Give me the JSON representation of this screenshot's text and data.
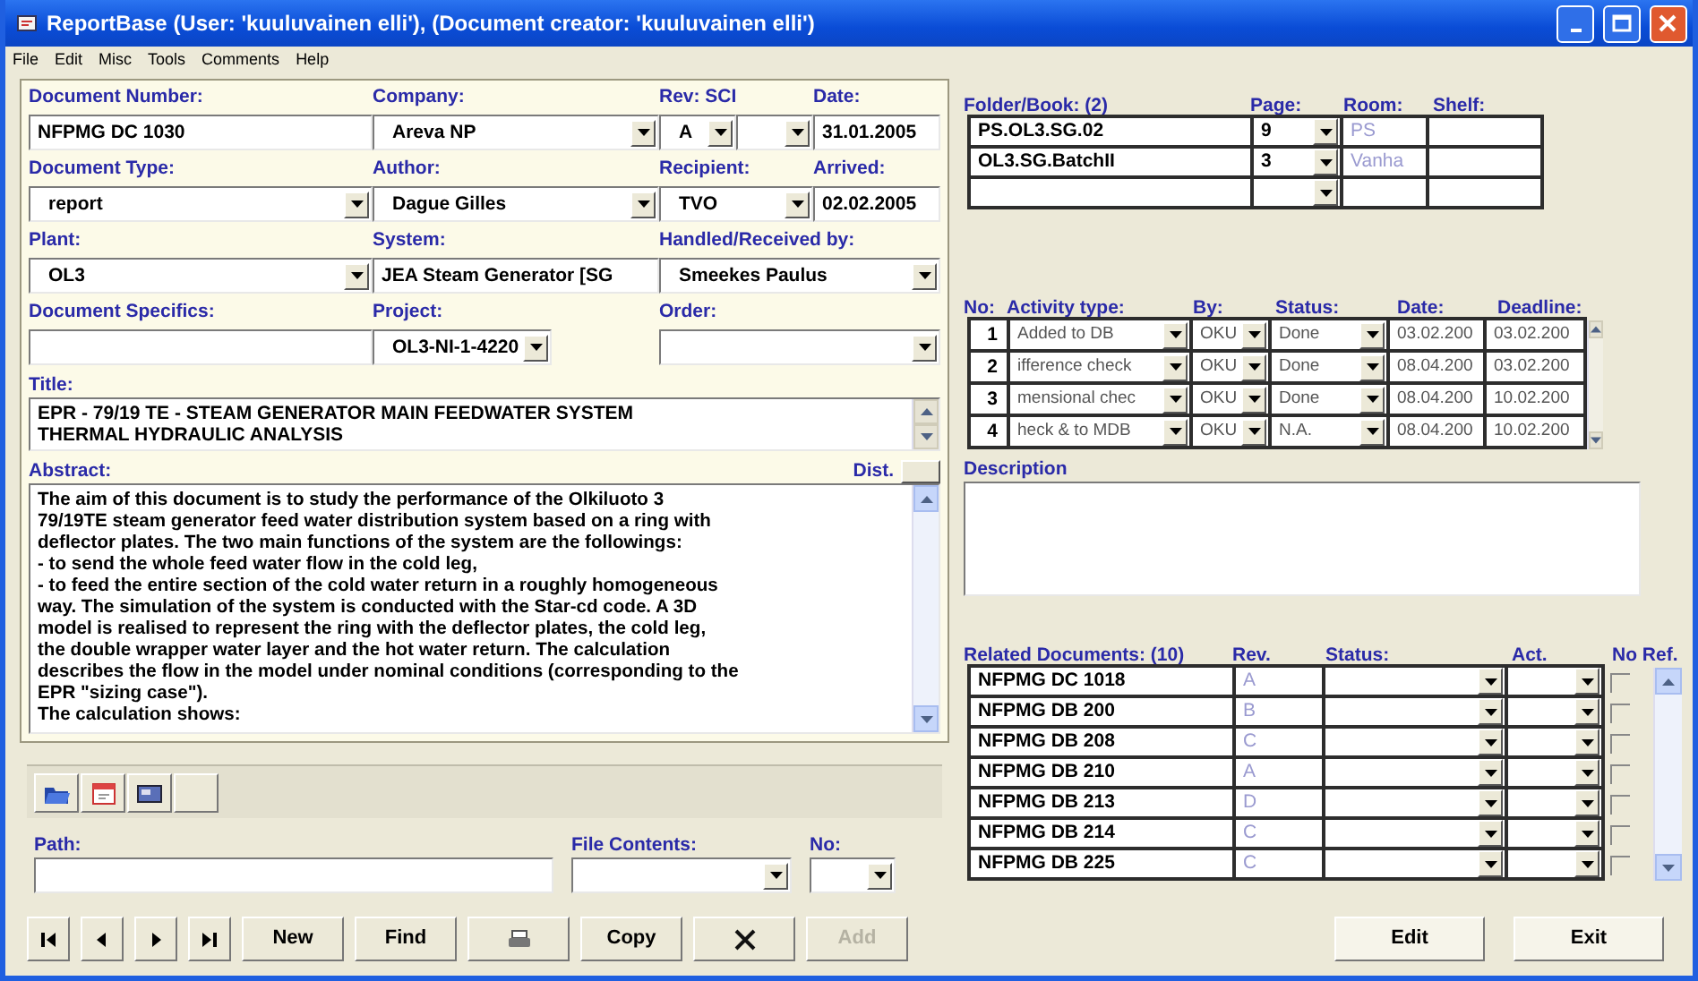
{
  "window": {
    "title": "ReportBase (User: 'kuuluvainen elli'), (Document creator: 'kuuluvainen elli')"
  },
  "menu": [
    "File",
    "Edit",
    "Misc",
    "Tools",
    "Comments",
    "Help"
  ],
  "document": {
    "rows": [
      [
        {
          "label": "Document Number:",
          "kind": "text",
          "value": "NFPMG DC 1030"
        },
        {
          "label": "Company:",
          "kind": "combo",
          "value": "Areva NP"
        },
        {
          "label": "Rev: SCI",
          "kind": "pair",
          "value": "A"
        },
        {
          "label": "Date:",
          "kind": "text",
          "value": "31.01.2005"
        }
      ],
      [
        {
          "label": "Document Type:",
          "kind": "combo",
          "value": "report"
        },
        {
          "label": "Author:",
          "kind": "combo",
          "value": "Dague Gilles"
        },
        {
          "label": "Recipient:",
          "kind": "combo",
          "value": "TVO"
        },
        {
          "label": "Arrived:",
          "kind": "text",
          "value": "02.02.2005"
        }
      ],
      [
        {
          "label": "Plant:",
          "kind": "combo",
          "value": "OL3"
        },
        {
          "label": "System:",
          "kind": "text",
          "value": "JEA Steam Generator [SG"
        },
        {
          "label": "Handled/Received by:",
          "kind": "combo",
          "value": "Smeekes Paulus"
        }
      ],
      [
        {
          "label": "Document Specifics:",
          "kind": "text"
        },
        {
          "label": "Project:",
          "kind": "short",
          "value": "OL3-NI-1-4220"
        },
        {
          "label": "Order:",
          "kind": "combo"
        }
      ]
    ],
    "title_label": "Title:",
    "title": "EPR - 79/19 TE - STEAM GENERATOR MAIN FEEDWATER SYSTEM\nTHERMAL HYDRAULIC ANALYSIS",
    "abstract_label": "Abstract:",
    "dist_label": "Dist.",
    "abstract": "The aim of this document is to study the performance of the Olkiluoto 3\n79/19TE steam generator feed water distribution system based on a ring with\ndeflector plates. The two main functions of the system are the followings:\n- to send the whole feed water flow in the cold leg,\n- to feed the entire section of the cold water return in a roughly homogeneous\nway. The simulation of the system is conducted with the Star-cd code. A 3D\nmodel is realised to represent the ring with the deflector plates, the cold leg,\nthe double wrapper water layer and the hot water return. The calculation\ndescribes the flow in the model under nominal conditions (corresponding to the\nEPR \"sizing case\").\nThe calculation shows:"
  },
  "attachments": {
    "buttons": [
      {
        "kind": "folder"
      },
      {
        "kind": "calendar"
      },
      {
        "kind": "card"
      },
      {
        "kind": "blank"
      }
    ],
    "path_label": "Path:",
    "file_contents_label": "File Contents:",
    "no_label": "No:"
  },
  "navigation": [
    {
      "kind": "first"
    },
    {
      "kind": "prev"
    },
    {
      "kind": "next"
    },
    {
      "kind": "last"
    },
    {
      "kind": "text",
      "label": "New",
      "disabled": false
    },
    {
      "kind": "text",
      "label": "Find",
      "disabled": false
    },
    {
      "kind": "print"
    },
    {
      "kind": "text",
      "label": "Copy",
      "disabled": false
    },
    {
      "kind": "delete"
    },
    {
      "kind": "text",
      "label": "Add",
      "disabled": true
    }
  ],
  "folders": {
    "headers": [
      "Folder/Book: (2)",
      "Page:",
      "Room:",
      "Shelf:"
    ],
    "rows": [
      {
        "name": "PS.OL3.SG.02",
        "page": "9",
        "room": "PS"
      },
      {
        "name": "OL3.SG.BatchII",
        "page": "3",
        "room": "Vanha"
      }
    ]
  },
  "activities": {
    "headers": [
      "No:",
      "Activity type:",
      "By:",
      "Status:",
      "Date:",
      "Deadline:"
    ],
    "rows": [
      {
        "no": "1",
        "type": "Added to DB",
        "by": "OKU",
        "status": "Done",
        "date": "03.02.200",
        "deadline": "03.02.200"
      },
      {
        "no": "2",
        "type": "ifference check",
        "by": "OKU",
        "status": "Done",
        "date": "08.04.200",
        "deadline": "03.02.200"
      },
      {
        "no": "3",
        "type": "mensional chec",
        "by": "OKU",
        "status": "Done",
        "date": "08.04.200",
        "deadline": "10.02.200"
      },
      {
        "no": "4",
        "type": "heck & to MDB",
        "by": "OKU",
        "status": "N.A.",
        "date": "08.04.200",
        "deadline": "10.02.200"
      }
    ]
  },
  "description_label": "Description",
  "related": {
    "headers": [
      "Related Documents: (10)",
      "Rev.",
      "Status:",
      "Act.",
      "No Ref."
    ],
    "rows": [
      {
        "doc": "NFPMG DC 1018",
        "rev": "A",
        "checked": false
      },
      {
        "doc": "NFPMG DB 200",
        "rev": "B",
        "checked": false
      },
      {
        "doc": "NFPMG DB 208",
        "rev": "C",
        "checked": false
      },
      {
        "doc": "NFPMG DB 210",
        "rev": "A",
        "checked": false
      },
      {
        "doc": "NFPMG DB 213",
        "rev": "D",
        "checked": false
      },
      {
        "doc": "NFPMG DB 214",
        "rev": "C",
        "checked": false
      },
      {
        "doc": "NFPMG DB 225",
        "rev": "C",
        "checked": false
      }
    ]
  },
  "actions": [
    "Edit",
    "Exit"
  ]
}
